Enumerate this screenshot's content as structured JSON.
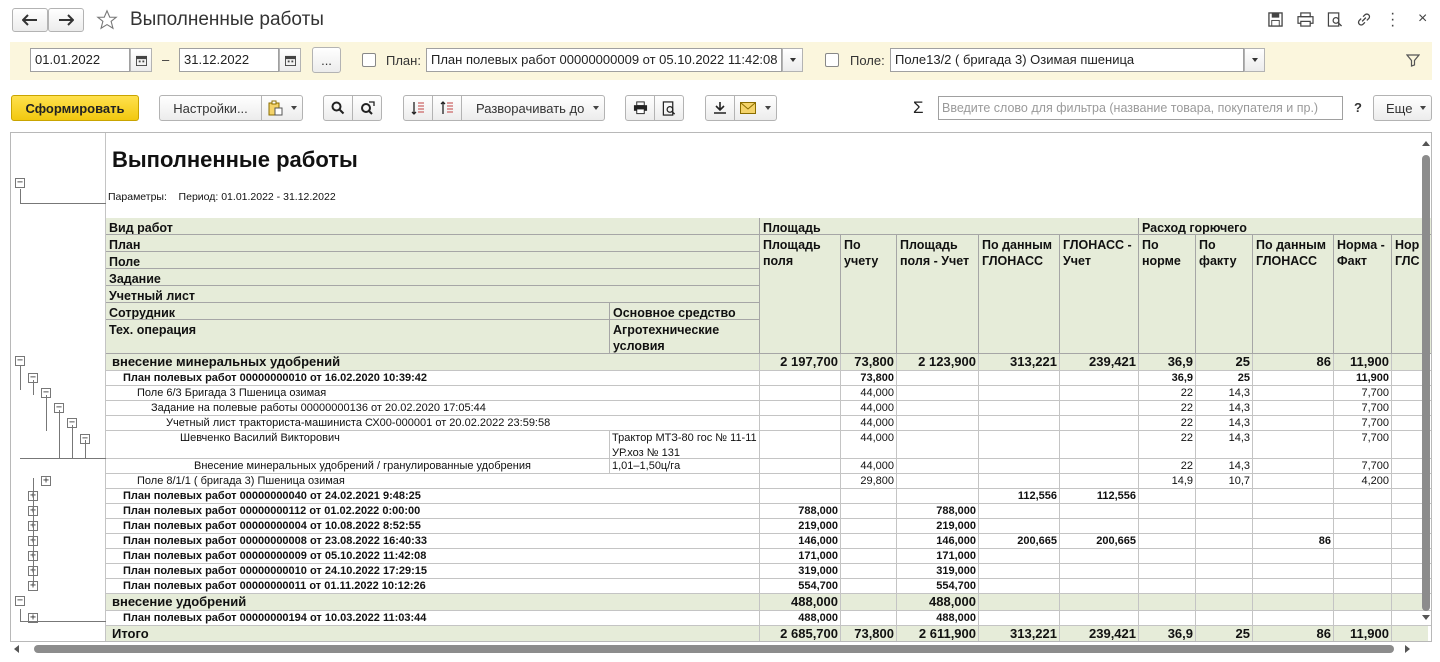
{
  "window": {
    "title": "Выполненные работы"
  },
  "filters": {
    "date_from": "01.01.2022",
    "date_sep": "–",
    "date_to": "31.12.2022",
    "more": "...",
    "plan_label": "План:",
    "plan_value": "План полевых работ 00000000009 от 05.10.2022 11:42:08",
    "field_label": "Поле:",
    "field_value": "Поле13/2 ( бригада 3)  Озимая пшеница"
  },
  "toolbar": {
    "generate": "Сформировать",
    "settings": "Настройки...",
    "expand_to": "Разворачивать до",
    "sigma": "Σ",
    "filter_placeholder": "Введите слово для фильтра (название товара, покупателя и пр.)",
    "help": "?",
    "more": "Еще"
  },
  "report": {
    "title": "Выполненные работы",
    "params": "Параметры:    Период: 01.01.2022 - 31.12.2022",
    "header": {
      "vid_rabot": "Вид работ",
      "plan": "План",
      "pole": "Поле",
      "zadanie": "Задание",
      "uchet_list": "Учетный лист",
      "sotrudnik": "Сотрудник",
      "osn_sredstvo": "Основное средство",
      "teh_oper": "Тех. операция",
      "agro": "Агротехнические условия",
      "ploshad": "Площадь",
      "rashod": "Расход горючего",
      "cols": [
        "Площадь поля",
        "По учету",
        "Площадь поля - Учет",
        "По данным ГЛОНАСС",
        "ГЛОНАСС - Учет",
        "По норме",
        "По факту",
        "По данным ГЛОНАСС",
        "Норма - Факт",
        "Нор ГЛС"
      ]
    },
    "rows": [
      {
        "kind": "group",
        "level": 0,
        "tog": "−",
        "label": "внесение минеральных удобрений",
        "extra": "",
        "v": [
          "2 197,700",
          "73,800",
          "2 123,900",
          "313,221",
          "239,421",
          "36,9",
          "25",
          "86",
          "11,900",
          ""
        ]
      },
      {
        "kind": "bold",
        "level": 1,
        "tog": "−",
        "label": "План полевых работ 00000000010 от 16.02.2020 10:39:42",
        "extra": "",
        "v": [
          "",
          "73,800",
          "",
          "",
          "",
          "36,9",
          "25",
          "",
          "11,900",
          ""
        ]
      },
      {
        "kind": "norm",
        "level": 2,
        "tog": "−",
        "label": "Поле 6/3 Бригада 3 Пшеница озимая",
        "extra": "",
        "v": [
          "",
          "44,000",
          "",
          "",
          "",
          "22",
          "14,3",
          "",
          "7,700",
          ""
        ]
      },
      {
        "kind": "norm",
        "level": 3,
        "tog": "−",
        "label": "Задание на полевые работы 00000000136 от 20.02.2020 17:05:44",
        "extra": "",
        "v": [
          "",
          "44,000",
          "",
          "",
          "",
          "22",
          "14,3",
          "",
          "7,700",
          ""
        ]
      },
      {
        "kind": "norm",
        "level": 4,
        "tog": "−",
        "label": "Учетный лист тракториста-машиниста СХ00-000001 от 20.02.2022 23:59:58",
        "extra": "",
        "v": [
          "",
          "44,000",
          "",
          "",
          "",
          "22",
          "14,3",
          "",
          "7,700",
          ""
        ]
      },
      {
        "kind": "tall",
        "level": 5,
        "tog": "−",
        "label": "Шевченко Василий Викторович",
        "extra": "Трактор  МТЗ-80 гос № 11-11 УР.хоз № 131",
        "v": [
          "",
          "44,000",
          "",
          "",
          "",
          "22",
          "14,3",
          "",
          "7,700",
          ""
        ]
      },
      {
        "kind": "norm",
        "level": 6,
        "tog": "",
        "label": "Внесение минеральных удобрений / гранулированные удобрения",
        "extra": "1,01–1,50ц/га",
        "v": [
          "",
          "44,000",
          "",
          "",
          "",
          "22",
          "14,3",
          "",
          "7,700",
          ""
        ]
      },
      {
        "kind": "norm",
        "level": 2,
        "tog": "+",
        "label": "Поле 8/1/1 ( бригада 3) Пшеница озимая",
        "extra": "",
        "v": [
          "",
          "29,800",
          "",
          "",
          "",
          "14,9",
          "10,7",
          "",
          "4,200",
          ""
        ]
      },
      {
        "kind": "bold",
        "level": 1,
        "tog": "+",
        "label": "План полевых работ 00000000040 от 24.02.2021 9:48:25",
        "extra": "",
        "v": [
          "",
          "",
          "",
          "112,556",
          "112,556",
          "",
          "",
          "",
          "",
          ""
        ]
      },
      {
        "kind": "bold",
        "level": 1,
        "tog": "+",
        "label": "План полевых работ 00000000112 от 01.02.2022 0:00:00",
        "extra": "",
        "v": [
          "788,000",
          "",
          "788,000",
          "",
          "",
          "",
          "",
          "",
          "",
          ""
        ]
      },
      {
        "kind": "bold",
        "level": 1,
        "tog": "+",
        "label": "План полевых работ 00000000004 от 10.08.2022 8:52:55",
        "extra": "",
        "v": [
          "219,000",
          "",
          "219,000",
          "",
          "",
          "",
          "",
          "",
          "",
          ""
        ]
      },
      {
        "kind": "bold",
        "level": 1,
        "tog": "+",
        "label": "План полевых работ 00000000008 от 23.08.2022 16:40:33",
        "extra": "",
        "v": [
          "146,000",
          "",
          "146,000",
          "200,665",
          "200,665",
          "",
          "",
          "86",
          "",
          ""
        ]
      },
      {
        "kind": "bold",
        "level": 1,
        "tog": "+",
        "label": "План полевых работ 00000000009 от 05.10.2022 11:42:08",
        "extra": "",
        "v": [
          "171,000",
          "",
          "171,000",
          "",
          "",
          "",
          "",
          "",
          "",
          ""
        ]
      },
      {
        "kind": "bold",
        "level": 1,
        "tog": "+",
        "label": "План полевых работ 00000000010 от 24.10.2022 17:29:15",
        "extra": "",
        "v": [
          "319,000",
          "",
          "319,000",
          "",
          "",
          "",
          "",
          "",
          "",
          ""
        ]
      },
      {
        "kind": "bold",
        "level": 1,
        "tog": "+",
        "label": "План полевых работ 00000000011 от 01.11.2022 10:12:26",
        "extra": "",
        "v": [
          "554,700",
          "",
          "554,700",
          "",
          "",
          "",
          "",
          "",
          "",
          ""
        ]
      },
      {
        "kind": "group",
        "level": 0,
        "tog": "−",
        "label": "внесение удобрений",
        "extra": "",
        "v": [
          "488,000",
          "",
          "488,000",
          "",
          "",
          "",
          "",
          "",
          "",
          ""
        ]
      },
      {
        "kind": "bold",
        "level": 1,
        "tog": "+",
        "label": "План полевых работ 00000000194 от 10.03.2022 11:03:44",
        "extra": "",
        "v": [
          "488,000",
          "",
          "488,000",
          "",
          "",
          "",
          "",
          "",
          "",
          ""
        ]
      },
      {
        "kind": "group",
        "level": -1,
        "tog": "",
        "label": "Итого",
        "extra": "",
        "v": [
          "2 685,700",
          "73,800",
          "2 611,900",
          "313,221",
          "239,421",
          "36,9",
          "25",
          "86",
          "11,900",
          ""
        ]
      }
    ]
  },
  "colors": {
    "accent": "#f7d21d",
    "header_bg": "#e6ecd9",
    "filter_bg": "#fbf6dd"
  }
}
